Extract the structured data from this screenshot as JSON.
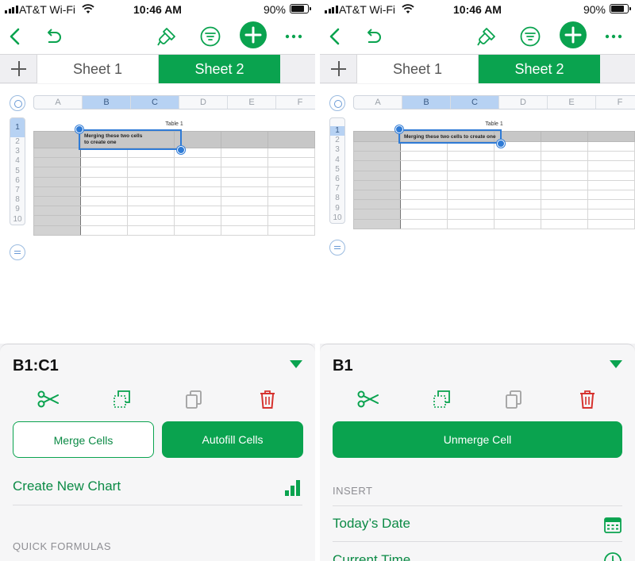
{
  "left": {
    "status": {
      "carrier": "AT&T Wi-Fi",
      "time": "10:46 AM",
      "battery": "90%"
    },
    "tabs": {
      "sheet1": "Sheet 1",
      "sheet2": "Sheet 2"
    },
    "columns": [
      "A",
      "B",
      "C",
      "D",
      "E",
      "F"
    ],
    "rows": [
      "1",
      "2",
      "3",
      "4",
      "5",
      "6",
      "7",
      "8",
      "9",
      "10"
    ],
    "table_title": "Table 1",
    "cell_text": "Merging these two cells to create one",
    "panel": {
      "title": "B1:C1",
      "merge_label": "Merge Cells",
      "autofill_label": "Autofill Cells",
      "chart_label": "Create New Chart",
      "section": "QUICK FORMULAS"
    }
  },
  "right": {
    "status": {
      "carrier": "AT&T Wi-Fi",
      "time": "10:46 AM",
      "battery": "90%"
    },
    "tabs": {
      "sheet1": "Sheet 1",
      "sheet2": "Sheet 2"
    },
    "columns": [
      "A",
      "B",
      "C",
      "D",
      "E",
      "F"
    ],
    "rows": [
      "1",
      "2",
      "3",
      "4",
      "5",
      "6",
      "7",
      "8",
      "9",
      "10"
    ],
    "table_title": "Table 1",
    "cell_text": "Merging these two cells to create one",
    "panel": {
      "title": "B1",
      "unmerge_label": "Unmerge Cell",
      "section": "INSERT",
      "date_label": "Today’s Date",
      "time_label": "Current Time"
    }
  },
  "colors": {
    "accent": "#0aa34f",
    "selection": "#2f7bd6",
    "header_fill": "#c7c7c7"
  }
}
